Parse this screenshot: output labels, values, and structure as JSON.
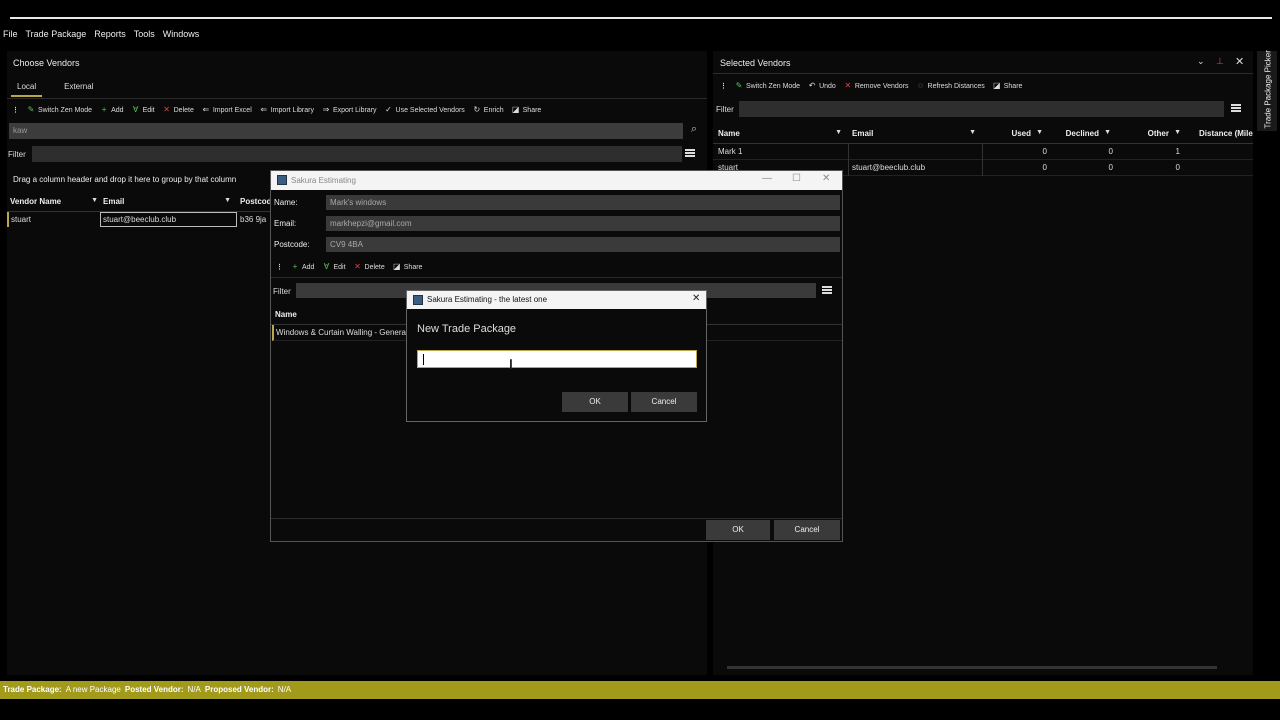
{
  "menu": [
    "File",
    "Trade Package",
    "Reports",
    "Tools",
    "Windows"
  ],
  "choose_vendors": {
    "title": "Choose Vendors",
    "tabs": [
      "Local",
      "External"
    ],
    "toolbar": [
      "Switch Zen Mode",
      "Add",
      "Edit",
      "Delete",
      "Import Excel",
      "Import Library",
      "Export Library",
      "Use Selected Vendors",
      "Enrich",
      "Share"
    ],
    "search_value": "kaw",
    "filter_label": "Filter",
    "group_hint": "Drag a column header and drop it here to group by that column",
    "columns": [
      "Vendor Name",
      "Email",
      "Postcode"
    ],
    "rows": [
      {
        "name": "stuart",
        "email": "stuart@beeclub.club",
        "postcode": "b36 9ja"
      }
    ]
  },
  "selected_vendors": {
    "title": "Selected Vendors",
    "toolbar": [
      "Switch Zen Mode",
      "Undo",
      "Remove Vendors",
      "Refresh Distances",
      "Share"
    ],
    "filter_label": "Filter",
    "columns": [
      "Name",
      "Email",
      "Used",
      "Declined",
      "Other",
      "Distance (Mile"
    ],
    "rows": [
      {
        "name": "Mark 1",
        "email": "",
        "used": "0",
        "declined": "0",
        "other": "1"
      },
      {
        "name": "stuart",
        "email": "stuart@beeclub.club",
        "used": "0",
        "declined": "0",
        "other": "0"
      }
    ],
    "side_tab": "Trade Package Picker"
  },
  "vendor_dialog": {
    "title": "Sakura Estimating",
    "name_label": "Name:",
    "name_value": "Mark's windows",
    "email_label": "Email:",
    "email_value": "markhepzi@gmail.com",
    "postcode_label": "Postcode:",
    "postcode_value": "CV9 4BA",
    "toolbar": [
      "Add",
      "Edit",
      "Delete",
      "Share"
    ],
    "filter_label": "Filter",
    "column": "Name",
    "row": "Windows & Curtain Walling - General",
    "ok": "OK",
    "cancel": "Cancel"
  },
  "new_package_dialog": {
    "title": "Sakura Estimating - the latest one",
    "heading": "New Trade Package",
    "input_value": "",
    "ok": "OK",
    "cancel": "Cancel"
  },
  "status": {
    "trade_package_label": "Trade Package:",
    "trade_package_value": "A new Package",
    "posted_label": "Posted Vendor:",
    "posted_value": "N/A",
    "proposed_label": "Proposed Vendor:",
    "proposed_value": "N/A"
  },
  "colors": {
    "accent": "#b8a84a",
    "status_bar": "#a19a1a"
  }
}
